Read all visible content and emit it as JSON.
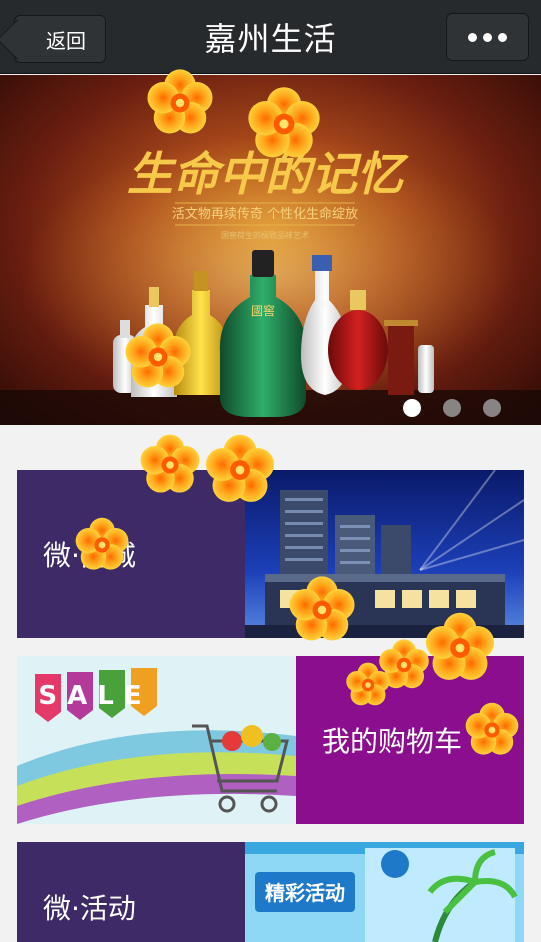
{
  "navbar": {
    "back_label": "返回",
    "title": "嘉州生活"
  },
  "banner": {
    "headline": "生命中的记忆",
    "tagline": "活文物再续传奇  个性化生命绽放",
    "subtagline": "国窖荷生的极致品味艺术",
    "bottle_label": "國窖",
    "slide_count": 3,
    "active_slide": 1
  },
  "tiles": [
    {
      "label": "微·商城"
    },
    {
      "label": "我的购物车",
      "image_text": "SALE"
    },
    {
      "label": "微·活动",
      "image_text": "精彩活动"
    }
  ],
  "colors": {
    "navbar": "#262a2d",
    "tile_purple": "#3d2a66",
    "tile_magenta": "#8b0e8e",
    "flower": "#f7b51e"
  }
}
